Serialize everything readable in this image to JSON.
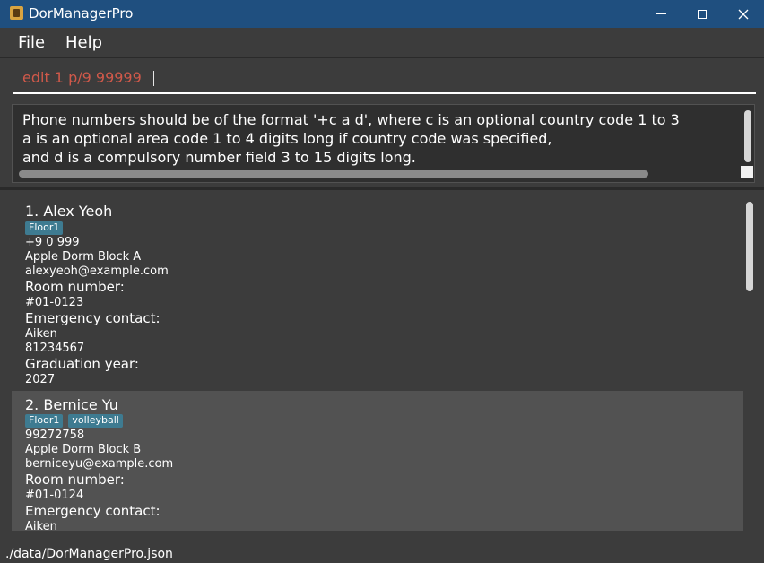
{
  "window": {
    "title": "DorManagerPro",
    "icon": "app-icon",
    "controls": [
      "minimize-icon",
      "maximize-icon",
      "close-icon"
    ]
  },
  "menu": {
    "file": "File",
    "help": "Help"
  },
  "command_box": {
    "value": "edit 1 p/9 99999",
    "text_color": "#d0594a"
  },
  "result_display": {
    "lines": [
      "Phone numbers should be of the format '+c a d', where c is an optional country code 1 to 3",
      "a is an optional area code 1 to 4 digits long if country code was specified,",
      "and d is a compulsory number field 3 to 15 digits long."
    ]
  },
  "persons": [
    {
      "title": "1. Alex Yeoh",
      "tags": [
        "Floor1"
      ],
      "phone": "+9 0 999",
      "address": "Apple Dorm Block A",
      "email": "alexyeoh@example.com",
      "room_label": "Room number:",
      "room": "#01-0123",
      "emergency_label": "Emergency contact:",
      "emergency_name": "Aiken",
      "emergency_phone": "81234567",
      "grad_label": "Graduation year:",
      "grad_year": "2027"
    },
    {
      "title": "2. Bernice Yu",
      "tags": [
        "Floor1",
        "volleyball"
      ],
      "phone": "99272758",
      "address": "Apple Dorm Block B",
      "email": "berniceyu@example.com",
      "room_label": "Room number:",
      "room": "#01-0124",
      "emergency_label": "Emergency contact:",
      "emergency_name": "Aiken"
    }
  ],
  "status_bar": {
    "path": "./data/DorManagerPro.json"
  },
  "colors": {
    "title_bar": "#1f4f7f",
    "background": "#3c3c3c",
    "selected_card": "#525252",
    "tag": "#3e7b91"
  }
}
